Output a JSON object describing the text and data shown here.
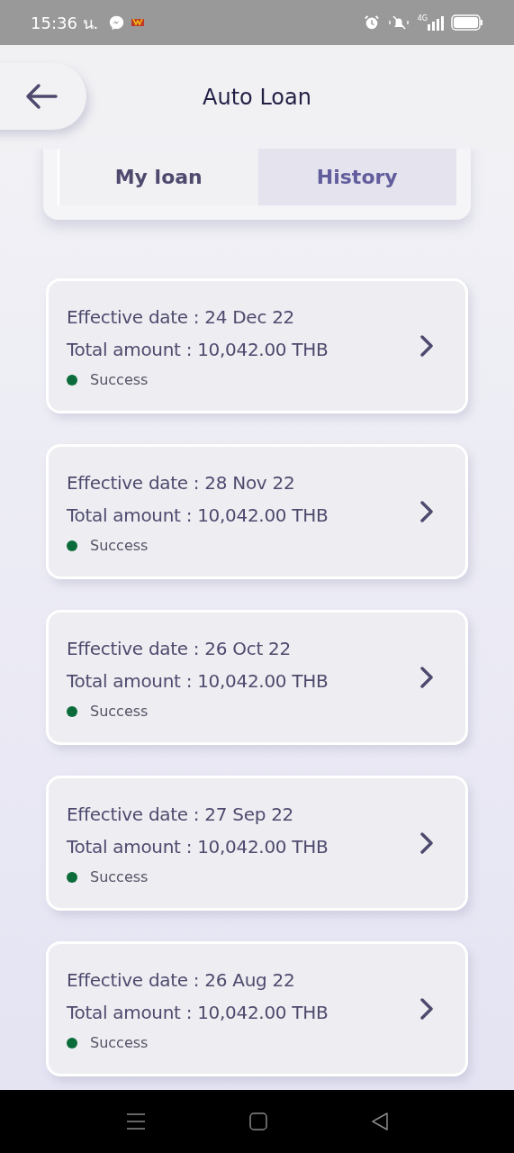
{
  "status_bar": {
    "time": "15:36 น.",
    "network_type": "4G"
  },
  "header": {
    "title": "Auto Loan"
  },
  "tabs": [
    {
      "label": "My loan",
      "selected": false
    },
    {
      "label": "History",
      "selected": true
    }
  ],
  "loans": [
    {
      "effective_date": "Effective date : 24 Dec 22",
      "total_amount": "Total amount : 10,042.00 THB",
      "status": "Success",
      "color": "#0b6b3a"
    },
    {
      "effective_date": "Effective date : 28 Nov 22",
      "total_amount": "Total amount : 10,042.00 THB",
      "status": "Success",
      "color": "#0b6b3a"
    },
    {
      "effective_date": "Effective date : 26 Oct 22",
      "total_amount": "Total amount : 10,042.00 THB",
      "status": "Success",
      "color": "#0b6b3a"
    },
    {
      "effective_date": "Effective date : 27 Sep 22",
      "total_amount": "Total amount : 10,042.00 THB",
      "status": "Success",
      "color": "#0b6b3a"
    },
    {
      "effective_date": "Effective date : 26 Aug 22",
      "total_amount": "Total amount : 10,042.00 THB",
      "status": "Success",
      "color": "#0b6b3a"
    }
  ]
}
